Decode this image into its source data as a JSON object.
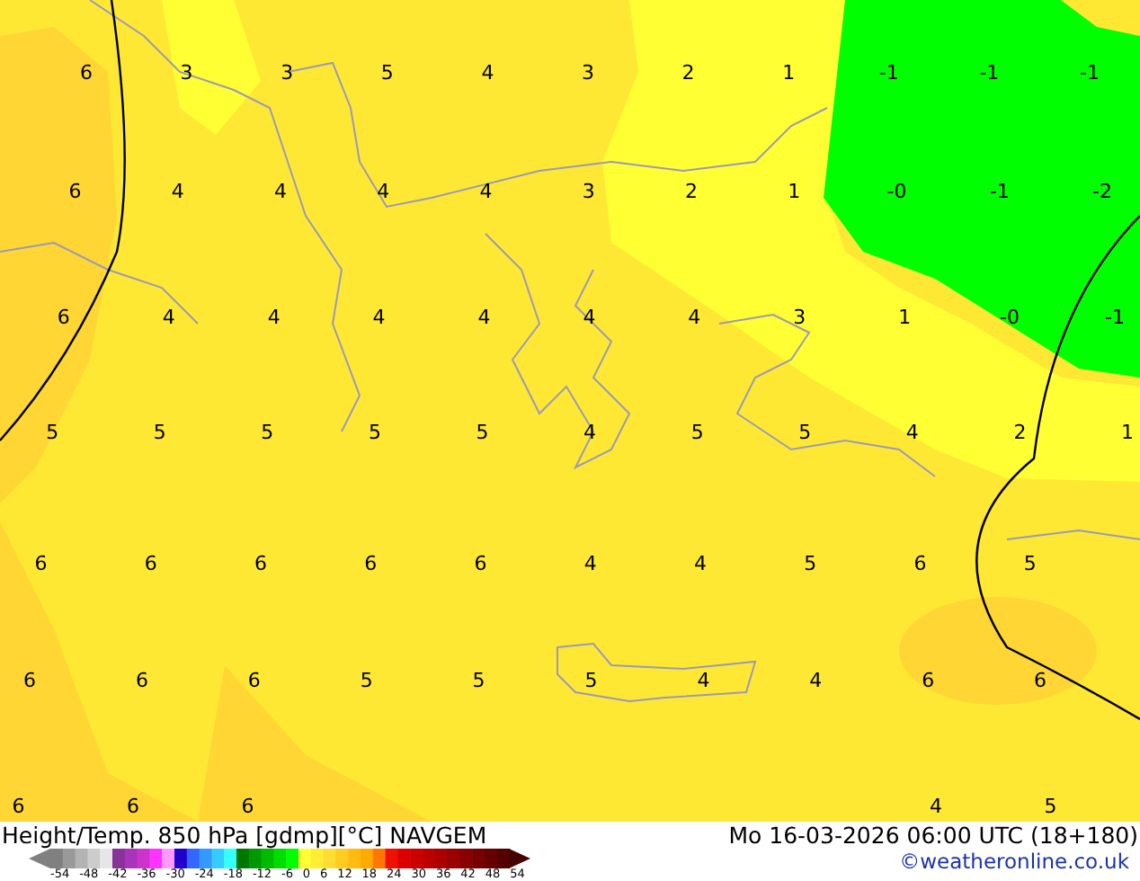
{
  "map": {
    "value_rows": [
      [
        "6",
        "3",
        "3",
        "5",
        "4",
        "3",
        "2",
        "1",
        "-1",
        "-1",
        "-1"
      ],
      [
        "6",
        "4",
        "4",
        "4",
        "4",
        "3",
        "2",
        "1",
        "-0",
        "-1",
        "-2"
      ],
      [
        "6",
        "4",
        "4",
        "4",
        "4",
        "4",
        "4",
        "3",
        "1",
        "-0",
        "-1"
      ],
      [
        "5",
        "5",
        "5",
        "5",
        "5",
        "4",
        "5",
        "5",
        "4",
        "2",
        "1"
      ],
      [
        "6",
        "6",
        "6",
        "6",
        "6",
        "4",
        "4",
        "5",
        "6",
        "5"
      ],
      [
        "6",
        "6",
        "6",
        "5",
        "5",
        "5",
        "4",
        "4",
        "6",
        "6"
      ],
      [
        "6",
        "6",
        "6",
        null,
        null,
        null,
        null,
        null,
        "4",
        "5"
      ]
    ]
  },
  "legend": {
    "labels": [
      "-54",
      "-48",
      "-42",
      "-36",
      "-30",
      "-24",
      "-18",
      "-12",
      "-6",
      "0",
      "6",
      "12",
      "18",
      "24",
      "30",
      "36",
      "42",
      "48",
      "54"
    ]
  },
  "title": "Height/Temp. 850 hPa [gdmp][°C] NAVGEM",
  "datetime": "Mo 16-03-2026 06:00 UTC (18+180)",
  "credit": "©weatheronline.co.uk"
}
